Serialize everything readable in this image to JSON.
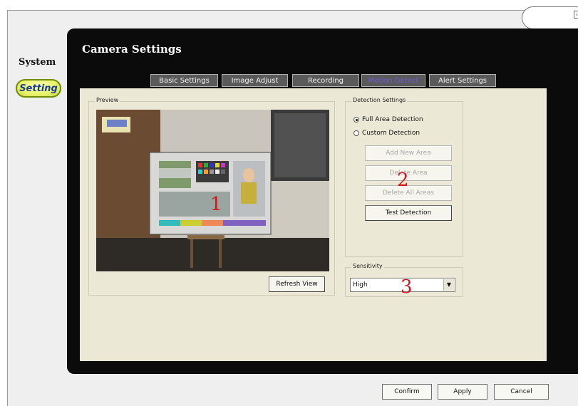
{
  "nav": {
    "system_label": "System",
    "setting_label": "Setting"
  },
  "header": {
    "title": "Camera Settings"
  },
  "tabs": [
    {
      "label": "Basic Settings"
    },
    {
      "label": "Image Adjust"
    },
    {
      "label": "Recording"
    },
    {
      "label": "Motion Detect",
      "active": true
    },
    {
      "label": "Alert Settings"
    }
  ],
  "preview": {
    "group_label": "Preview",
    "refresh_label": "Refresh View",
    "marker": "1"
  },
  "detection": {
    "group_label": "Detection Settings",
    "options": [
      {
        "label": "Full Area Detection",
        "selected": true
      },
      {
        "label": "Custom Detection",
        "selected": false
      }
    ],
    "buttons": {
      "add": "Add New Area",
      "delete": "Delete Area",
      "delete_all": "Delete All Areas",
      "test": "Test Detection"
    },
    "marker": "2"
  },
  "sensitivity": {
    "group_label": "Sensitivity",
    "value": "High",
    "marker": "3"
  },
  "footer": {
    "confirm": "Confirm",
    "apply": "Apply",
    "cancel": "Cancel"
  },
  "colors": {
    "accent": "#6d5ad8",
    "marker": "#d4161c",
    "setting_bg": "#e9f26a",
    "panel": "#0b0b0b"
  }
}
